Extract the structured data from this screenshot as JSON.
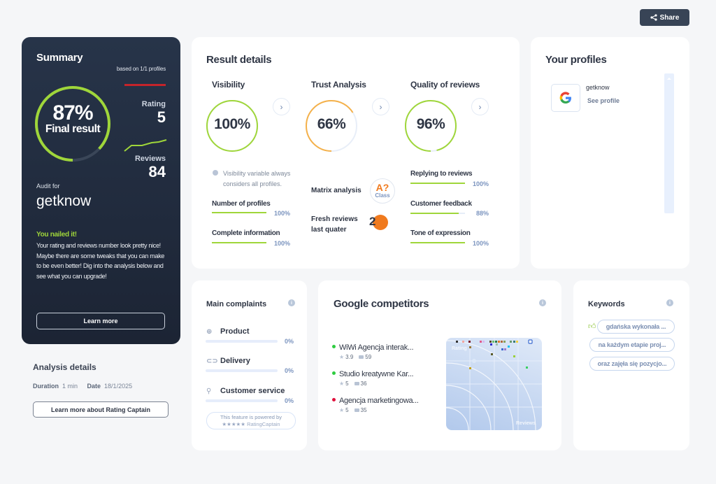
{
  "header": {
    "share_label": "Share"
  },
  "summary": {
    "title": "Summary",
    "based_on": "based on 1/1 profiles",
    "final_pct": "87%",
    "final_pct_value": 87,
    "final_label": "Final result",
    "rating_label": "Rating",
    "rating_value": "5",
    "reviews_label": "Reviews",
    "reviews_value": "84",
    "audit_label": "Audit for",
    "audit_name": "getknow",
    "nailed": "You nailed it!",
    "message": "Your rating and reviews number look pretty nice! Maybe there are some tweaks that you can make to be even better! Dig into the analysis below and see what you can upgrade!",
    "learn_more": "Learn more",
    "colors": {
      "accent": "#9fd63a",
      "red": "#c4242a"
    }
  },
  "analysis": {
    "title": "Analysis details",
    "duration_label": "Duration",
    "duration_value": "1 min",
    "date_label": "Date",
    "date_value": "18/1/2025",
    "button": "Learn more about Rating Captain"
  },
  "result": {
    "title": "Result details",
    "visibility": {
      "title": "Visibility",
      "value": "100%",
      "pct": 100,
      "note": "Visibility variable always considers all profiles.",
      "metrics": [
        {
          "label": "Number of profiles",
          "value": "100%",
          "pct": 100
        },
        {
          "label": "Complete information",
          "value": "100%",
          "pct": 100
        }
      ]
    },
    "trust": {
      "title": "Trust Analysis",
      "value": "66%",
      "pct": 66,
      "matrix_label": "Matrix analysis",
      "matrix_grade": "A?",
      "matrix_class": "Class",
      "fresh_label_1": "Fresh reviews",
      "fresh_label_2": "last quater",
      "fresh_value": "2"
    },
    "quality": {
      "title": "Quality of reviews",
      "value": "96%",
      "pct": 96,
      "metrics": [
        {
          "label": "Replying to reviews",
          "value": "100%",
          "pct": 100
        },
        {
          "label": "Customer feedback",
          "value": "88%",
          "pct": 88
        },
        {
          "label": "Tone of expression",
          "value": "100%",
          "pct": 100
        }
      ]
    },
    "colors": {
      "green": "#9fd63a",
      "orange": "#f5b14a",
      "track": "#e8eef8"
    }
  },
  "profiles": {
    "title": "Your profiles",
    "items": [
      {
        "name": "getknow",
        "link": "See profile",
        "icon": "google-icon"
      }
    ]
  },
  "complaints": {
    "title": "Main complaints",
    "items": [
      {
        "label": "Product",
        "value": "0%",
        "icon": "basket-icon"
      },
      {
        "label": "Delivery",
        "value": "0%",
        "icon": "truck-icon"
      },
      {
        "label": "Customer service",
        "value": "0%",
        "icon": "person-icon"
      }
    ],
    "powered_1": "This feature is powered by",
    "powered_2": "★★★★★ RatingCaptain"
  },
  "competitors": {
    "title": "Google competitors",
    "items": [
      {
        "name": "WiWi Agencja interak...",
        "rating": "3.9",
        "reviews": "59",
        "color": "#2ecc40"
      },
      {
        "name": "Studio kreatywne Kar...",
        "rating": "5",
        "reviews": "36",
        "color": "#2ecc40"
      },
      {
        "name": "Agencja marketingowa...",
        "rating": "5",
        "reviews": "35",
        "color": "#e0103c"
      }
    ],
    "chart_x_label": "Reviews",
    "chart_y_label": "Rating"
  },
  "keywords": {
    "title": "Keywords",
    "items": [
      "gdańska wykonała ...",
      "na każdym etapie proj...",
      "oraz zajęła się pozycjo..."
    ]
  }
}
